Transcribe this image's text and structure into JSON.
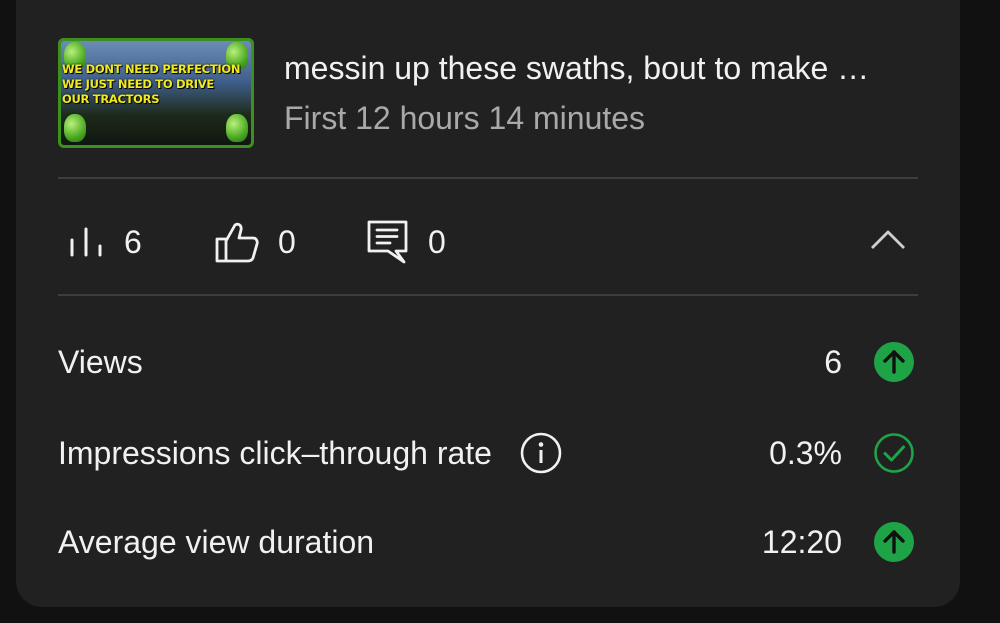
{
  "video": {
    "title": "messin up these swaths, bout to make …",
    "period": "First 12 hours 14 minutes",
    "thumbnail_text": "WE DONT NEED PERFECTION\nWE JUST NEED TO DRIVE\nOUR TRACTORS"
  },
  "stats": {
    "views": "6",
    "likes": "0",
    "comments": "0"
  },
  "metrics": [
    {
      "label": "Views",
      "value": "6",
      "status_icon": "arrow-up-icon",
      "status_color": "#1ea446"
    },
    {
      "label": "Impressions click–through rate",
      "value": "0.3%",
      "status_icon": "check-circle-icon",
      "status_color": "#1ea446"
    },
    {
      "label": "Average view duration",
      "value": "12:20",
      "status_icon": "arrow-up-icon",
      "status_color": "#1ea446"
    }
  ],
  "colors": {
    "card_background": "#212121",
    "page_background": "#111111",
    "accent_green": "#1ea446",
    "secondary_text": "#a9a9a9"
  }
}
